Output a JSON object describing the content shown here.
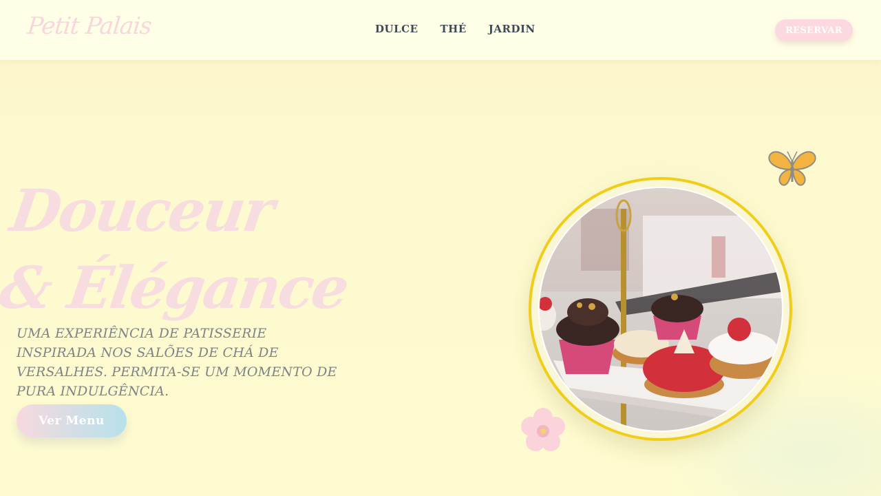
{
  "header": {
    "logo": "Petit Palais",
    "nav": [
      "DULCE",
      "THÉ",
      "JARDIN"
    ],
    "reserve_label": "RESERVAR"
  },
  "hero": {
    "title_line1": "Douceur",
    "title_line2": "& Élégance",
    "description": "Uma experiência de patisserie inspirada nos salões de chá de Versalhes. Permita-se um momento de pura indulgência.",
    "cta_label": "Ver Menu"
  },
  "colors": {
    "background": "#fefbd0",
    "accent_pink": "#f7d9df",
    "accent_gold": "#f2cd18",
    "accent_blue": "#b6e1ea",
    "nav_text": "#3f4a52"
  },
  "icons": {
    "decoration_1": "butterfly-icon",
    "decoration_2": "cherry-blossom-icon"
  }
}
